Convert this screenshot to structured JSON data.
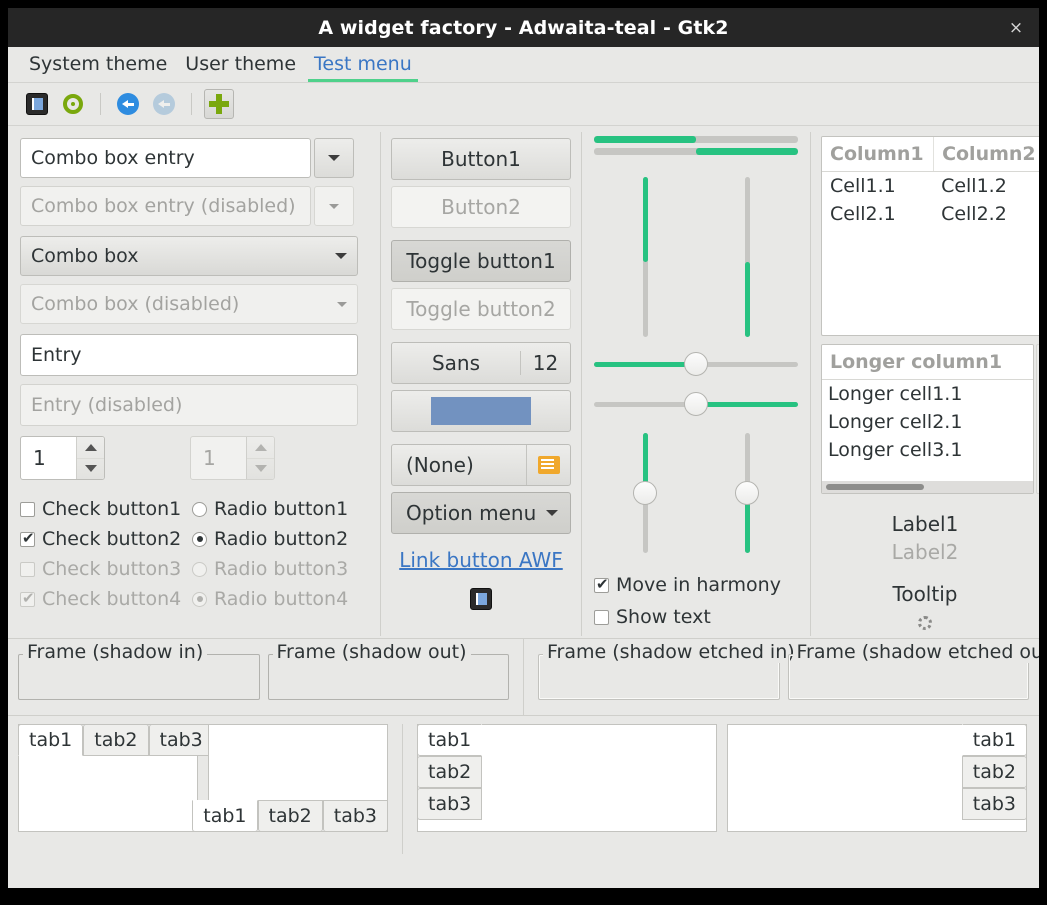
{
  "window": {
    "title": "A widget factory - Adwaita-teal - Gtk2",
    "close_label": "×"
  },
  "menubar": {
    "items": [
      {
        "label": "System theme",
        "active": false
      },
      {
        "label": "User theme",
        "active": false
      },
      {
        "label": "Test menu",
        "active": true
      }
    ]
  },
  "toolbar": {
    "icons": [
      {
        "name": "document-icon",
        "state": "pressed"
      },
      {
        "name": "refresh-icon",
        "state": "normal"
      },
      {
        "name": "back-arrow-icon",
        "state": "normal"
      },
      {
        "name": "back-arrow-disabled-icon",
        "state": "disabled"
      },
      {
        "name": "add-icon",
        "state": "framed"
      }
    ]
  },
  "column1": {
    "combo_entry": {
      "value": "Combo box entry",
      "placeholder": "Combo box entry"
    },
    "combo_entry_disabled": {
      "value": "Combo box entry (disabled)"
    },
    "combo": {
      "value": "Combo box"
    },
    "combo_disabled": {
      "value": "Combo box (disabled)"
    },
    "entry": {
      "value": "Entry"
    },
    "entry_disabled": {
      "value": "Entry (disabled)"
    },
    "spin": {
      "value": "1"
    },
    "spin_disabled": {
      "value": "1"
    },
    "checks": [
      {
        "check_label": "Check button1",
        "check_state": "unchecked",
        "check_disabled": false,
        "radio_label": "Radio button1",
        "radio_state": "unchecked",
        "radio_disabled": false
      },
      {
        "check_label": "Check button2",
        "check_state": "checked",
        "check_disabled": false,
        "radio_label": "Radio button2",
        "radio_state": "checked",
        "radio_disabled": false
      },
      {
        "check_label": "Check button3",
        "check_state": "unchecked",
        "check_disabled": true,
        "radio_label": "Radio button3",
        "radio_state": "unchecked",
        "radio_disabled": true
      },
      {
        "check_label": "Check button4",
        "check_state": "checked",
        "check_disabled": true,
        "radio_label": "Radio button4",
        "radio_state": "checked",
        "radio_disabled": true
      }
    ]
  },
  "column2": {
    "button1": "Button1",
    "button2": "Button2",
    "toggle1": "Toggle button1",
    "toggle2": "Toggle button2",
    "font_name": "Sans",
    "font_size": "12",
    "color_value": "#7292c0",
    "file_label": "(None)",
    "option_menu": "Option menu",
    "link_button": "Link button AWF"
  },
  "column3": {
    "progress1_percent": 50,
    "progress2_percent": 50,
    "vscale1_percent": 53,
    "vscale2_percent": 47,
    "hscale1_percent": 50,
    "hscale2_percent": 50,
    "vscale3_percent": 50,
    "vscale4_percent": 50,
    "check_harmony": {
      "label": "Move in harmony",
      "state": "checked"
    },
    "check_showtext": {
      "label": "Show text",
      "state": "unchecked"
    }
  },
  "column4": {
    "treeview1": {
      "columns": [
        "Column1",
        "Column2"
      ],
      "rows": [
        [
          "Cell1.1",
          "Cell1.2"
        ],
        [
          "Cell2.1",
          "Cell2.2"
        ]
      ]
    },
    "treeview2": {
      "columns": [
        "Longer column1"
      ],
      "rows": [
        [
          "Longer cell1.1"
        ],
        [
          "Longer cell2.1"
        ],
        [
          "Longer cell3.1"
        ]
      ]
    },
    "label1": "Label1",
    "label2": "Label2",
    "tooltip": "Tooltip"
  },
  "frames": [
    {
      "label": "Frame (shadow in)",
      "style": "in"
    },
    {
      "label": "Frame (shadow out)",
      "style": "out"
    },
    {
      "label": "Frame (shadow etched in)",
      "style": "etched-in"
    },
    {
      "label": "Frame (shadow etched out)",
      "style": "etched-out"
    }
  ],
  "notebooks": [
    {
      "position": "top",
      "tabs": [
        "tab1",
        "tab2",
        "tab3"
      ],
      "selected": 0
    },
    {
      "position": "bottom",
      "tabs": [
        "tab1",
        "tab2",
        "tab3"
      ],
      "selected": 0
    },
    {
      "position": "left",
      "tabs": [
        "tab1",
        "tab2",
        "tab3"
      ],
      "selected": 0
    },
    {
      "position": "right",
      "tabs": [
        "tab1",
        "tab2",
        "tab3"
      ],
      "selected": 0
    }
  ],
  "colors": {
    "accent_green": "#27c281",
    "link_blue": "#3a76c4",
    "titlebar_bg": "#262626",
    "window_bg": "#e8e8e6"
  }
}
